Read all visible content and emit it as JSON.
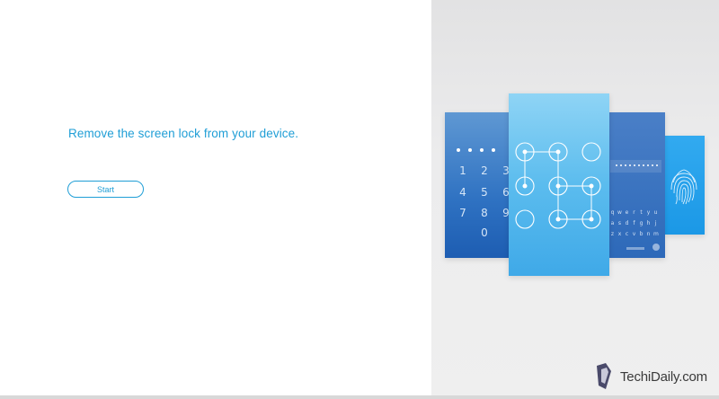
{
  "main": {
    "headline": "Remove the screen lock from your device.",
    "start_label": "Start"
  },
  "illustration": {
    "pin_keys": [
      "1",
      "2",
      "3",
      "4",
      "5",
      "6",
      "7",
      "8",
      "9",
      "0"
    ],
    "keyboard_rows": [
      [
        "q",
        "w",
        "e",
        "r",
        "t",
        "y",
        "u",
        "i",
        "o",
        "p"
      ],
      [
        "a",
        "s",
        "d",
        "f",
        "g",
        "h",
        "j",
        "k",
        "l"
      ],
      [
        "z",
        "x",
        "c",
        "v",
        "b",
        "n",
        "m"
      ]
    ]
  },
  "watermark": {
    "text": "TechiDaily.com"
  },
  "colors": {
    "accent": "#1f9ed6",
    "pin_card": "#2f72c2",
    "pattern_card": "#5bbcee",
    "password_card": "#2d69b9",
    "fingerprint_card": "#1b98e6"
  }
}
